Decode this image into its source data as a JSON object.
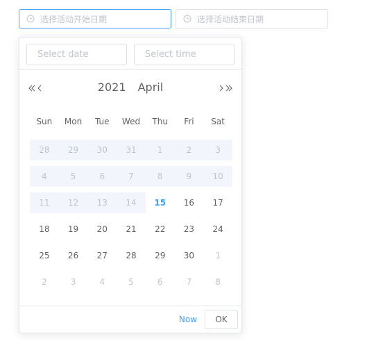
{
  "range": {
    "start_placeholder": "选择活动开始日期",
    "end_placeholder": "选择活动结束日期",
    "icon": "clock-icon"
  },
  "picker": {
    "date_placeholder": "Select date",
    "time_placeholder": "Select time",
    "year": "2021",
    "month": "April",
    "weekdays": [
      "Sun",
      "Mon",
      "Tue",
      "Wed",
      "Thu",
      "Fri",
      "Sat"
    ],
    "days": [
      {
        "d": "28",
        "kind": "past-prev"
      },
      {
        "d": "29",
        "kind": "past-prev"
      },
      {
        "d": "30",
        "kind": "past-prev"
      },
      {
        "d": "31",
        "kind": "past-prev"
      },
      {
        "d": "1",
        "kind": "past"
      },
      {
        "d": "2",
        "kind": "past"
      },
      {
        "d": "3",
        "kind": "past"
      },
      {
        "d": "4",
        "kind": "past"
      },
      {
        "d": "5",
        "kind": "past"
      },
      {
        "d": "6",
        "kind": "past"
      },
      {
        "d": "7",
        "kind": "past"
      },
      {
        "d": "8",
        "kind": "past"
      },
      {
        "d": "9",
        "kind": "past"
      },
      {
        "d": "10",
        "kind": "past"
      },
      {
        "d": "11",
        "kind": "past"
      },
      {
        "d": "12",
        "kind": "past"
      },
      {
        "d": "13",
        "kind": "past"
      },
      {
        "d": "14",
        "kind": "past"
      },
      {
        "d": "15",
        "kind": "today"
      },
      {
        "d": "16",
        "kind": "normal"
      },
      {
        "d": "17",
        "kind": "normal"
      },
      {
        "d": "18",
        "kind": "normal"
      },
      {
        "d": "19",
        "kind": "normal"
      },
      {
        "d": "20",
        "kind": "normal"
      },
      {
        "d": "21",
        "kind": "normal"
      },
      {
        "d": "22",
        "kind": "normal"
      },
      {
        "d": "23",
        "kind": "normal"
      },
      {
        "d": "24",
        "kind": "normal"
      },
      {
        "d": "25",
        "kind": "normal"
      },
      {
        "d": "26",
        "kind": "normal"
      },
      {
        "d": "27",
        "kind": "normal"
      },
      {
        "d": "28",
        "kind": "normal"
      },
      {
        "d": "29",
        "kind": "normal"
      },
      {
        "d": "30",
        "kind": "normal"
      },
      {
        "d": "1",
        "kind": "next"
      },
      {
        "d": "2",
        "kind": "next"
      },
      {
        "d": "3",
        "kind": "next"
      },
      {
        "d": "4",
        "kind": "next"
      },
      {
        "d": "5",
        "kind": "next"
      },
      {
        "d": "6",
        "kind": "next"
      },
      {
        "d": "7",
        "kind": "next"
      },
      {
        "d": "8",
        "kind": "next"
      }
    ],
    "now_label": "Now",
    "ok_label": "OK"
  },
  "colors": {
    "accent": "#409eff",
    "muted_text": "#c0c4cc",
    "disabled_bg": "#f2f6fc",
    "border": "#dcdfe6"
  }
}
